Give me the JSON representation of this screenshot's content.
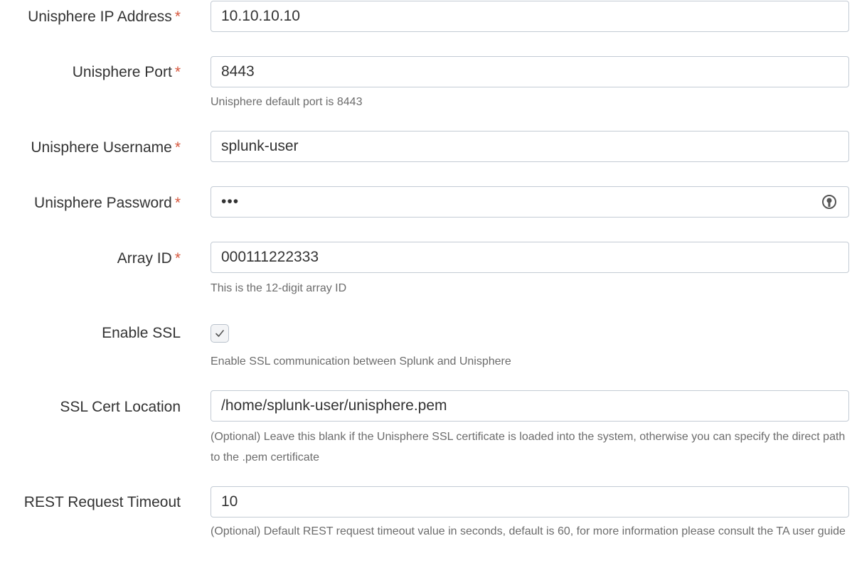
{
  "fields": {
    "ip_address": {
      "label": "Unisphere IP Address",
      "required_mark": "*",
      "value": "10.10.10.10"
    },
    "port": {
      "label": "Unisphere Port",
      "required_mark": "*",
      "value": "8443",
      "help": "Unisphere default port is 8443"
    },
    "username": {
      "label": "Unisphere Username",
      "required_mark": "*",
      "value": "splunk-user"
    },
    "password": {
      "label": "Unisphere Password",
      "required_mark": "*",
      "value": "•••",
      "reveal_icon": "eye-icon"
    },
    "array_id": {
      "label": "Array ID",
      "required_mark": "*",
      "value": "000111222333",
      "help": "This is the 12-digit array ID"
    },
    "enable_ssl": {
      "label": "Enable SSL",
      "checked": true,
      "help": "Enable SSL communication between Splunk and Unisphere"
    },
    "ssl_cert": {
      "label": "SSL Cert Location",
      "value": "/home/splunk-user/unisphere.pem",
      "help": "(Optional) Leave this blank if the Unisphere SSL certificate is loaded into the system, otherwise you can specify the direct path to the .pem certificate"
    },
    "timeout": {
      "label": "REST Request Timeout",
      "value": "10",
      "help": "(Optional) Default REST request timeout value in seconds, default is 60, for more information please consult the TA user guide"
    }
  },
  "colors": {
    "text": "#333333",
    "required": "#d6563c",
    "help_text": "#6c6c6c",
    "input_border": "#c3cbd4"
  }
}
